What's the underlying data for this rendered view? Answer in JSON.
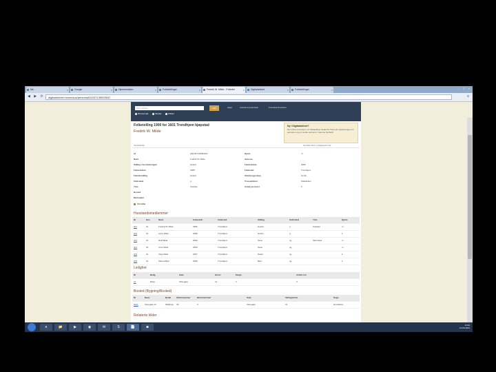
{
  "browser": {
    "tabs": [
      {
        "label": "Me"
      },
      {
        "label": "Google"
      },
      {
        "label": "Hjemmesiden"
      },
      {
        "label": "Folketellinger"
      },
      {
        "label": "Fredrik W. Milde - Folketel"
      },
      {
        "label": "Digitalarkivet"
      },
      {
        "label": "Folketellinger"
      }
    ],
    "active_tab": 4,
    "url": "digitalarkivet.no/census/person/pf01037139003047",
    "window_controls": "– □ ×",
    "nav_glyphs": "◀ ▶ ⟳",
    "menu_glyph": "≡"
  },
  "site": {
    "search_placeholder": "Søk i arkivet",
    "search_button": "Søk",
    "nav": [
      "Hjelp",
      "Avansert personsøk",
      "Fra kartet til arkivet"
    ],
    "radio_options": [
      "Personsøk",
      "Steder",
      "Kilder"
    ]
  },
  "record": {
    "title": "Folketelling 1900 for 1601 Trondhjem kjøpstad",
    "person_name": "Fredrik W. Milde",
    "help_title": "Ny i Digitalarkivet?",
    "help_text": "Her vises en person i en folketelling. Nedenfor finner du opplysninger om personen og om andre personer i samme hushold.",
    "links_left": "Vis kildeinfo",
    "links_right": "Se kilde   Skriv ut   Rapporter feil",
    "fields_left": [
      {
        "k": "Id",
        "v": "pf01037139003047"
      },
      {
        "k": "Navn",
        "v": "Fredrik W. Milde"
      },
      {
        "k": "Stilling i husholdningen",
        "v": "Husfar"
      },
      {
        "k": "Fødselsdato",
        "v": "1885"
      },
      {
        "k": "Familiestilling",
        "v": "Husfar"
      },
      {
        "k": "Sivilstand",
        "v": "g"
      },
      {
        "k": "Yrke",
        "v": "Snekker"
      },
      {
        "k": "Bosted",
        "v": ""
      },
      {
        "k": "Merknader",
        "v": ""
      }
    ],
    "fields_right": [
      {
        "k": "Kjønn",
        "v": "m"
      },
      {
        "k": "Adresse",
        "v": ""
      },
      {
        "k": "Fødselsdato",
        "v": "1885"
      },
      {
        "k": "Fødested",
        "v": "Trondhjem"
      },
      {
        "k": "Statsborgerskap",
        "v": "Norsk"
      },
      {
        "k": "Trossamfunn",
        "v": "Statskirken"
      },
      {
        "k": "Antall personer",
        "v": "5"
      }
    ],
    "status_flag": "Vis kilde"
  },
  "household": {
    "title": "Husstandsmedlemmer",
    "columns": [
      "Nr",
      "Hus",
      "Navn",
      "Fødselsår",
      "Fødested",
      "Stilling",
      "Sivilstand",
      "Yrke",
      "Kjønn"
    ],
    "rows": [
      [
        "001",
        "01",
        "Fredrik W. Milde",
        "1865",
        "Trondhjem",
        "Husfar",
        "g",
        "Snekker",
        "m"
      ],
      [
        "002",
        "01",
        "Anna Milde",
        "1868",
        "Trondhjem",
        "Hustru",
        "g",
        "",
        "k"
      ],
      [
        "003",
        "01",
        "Rolf Milde",
        "1890",
        "Trondhjem",
        "Sønn",
        "ug",
        "Skomaker",
        "m"
      ],
      [
        "004",
        "01",
        "Arne Milde",
        "1893",
        "Trondhjem",
        "Sønn",
        "ug",
        "",
        "m"
      ],
      [
        "005",
        "01",
        "Olga Milde",
        "1897",
        "Trondhjem",
        "Datter",
        "ug",
        "",
        "k"
      ],
      [
        "006",
        "01",
        "Maria Milde",
        "1899",
        "Trondhjem",
        "Barn",
        "ug",
        "",
        "k"
      ]
    ]
  },
  "dwelling": {
    "title": "Leilighet",
    "columns": [
      "Nr",
      "Bolig",
      "Gate",
      "Husnr",
      "Etasje",
      "Antall rom"
    ],
    "rows": [
      [
        "01",
        "Bolig",
        "Kirkegata",
        "12",
        "2",
        "3"
      ]
    ]
  },
  "property": {
    "title": "Bosted (Bygning/Bosted)",
    "columns": [
      "Nr",
      "Navn",
      "Bydel",
      "Gårdsnummer",
      "Bruksnummer",
      "Gate",
      "Tellingskrets",
      "Sogn"
    ],
    "rows": [
      [
        "0001",
        "Kirkegata 12",
        "Midtbyen",
        "33",
        "3",
        "Kirkegata",
        "01",
        "Domkirken"
      ]
    ]
  },
  "next_section": "Relaterte kilder",
  "taskbar": {
    "start": "Start",
    "items": [
      "e",
      "📁",
      "▶",
      "◉",
      "✉",
      "S",
      "📄",
      "◙"
    ],
    "active_item": 6,
    "time": "14:32",
    "date": "12.03.2014"
  }
}
